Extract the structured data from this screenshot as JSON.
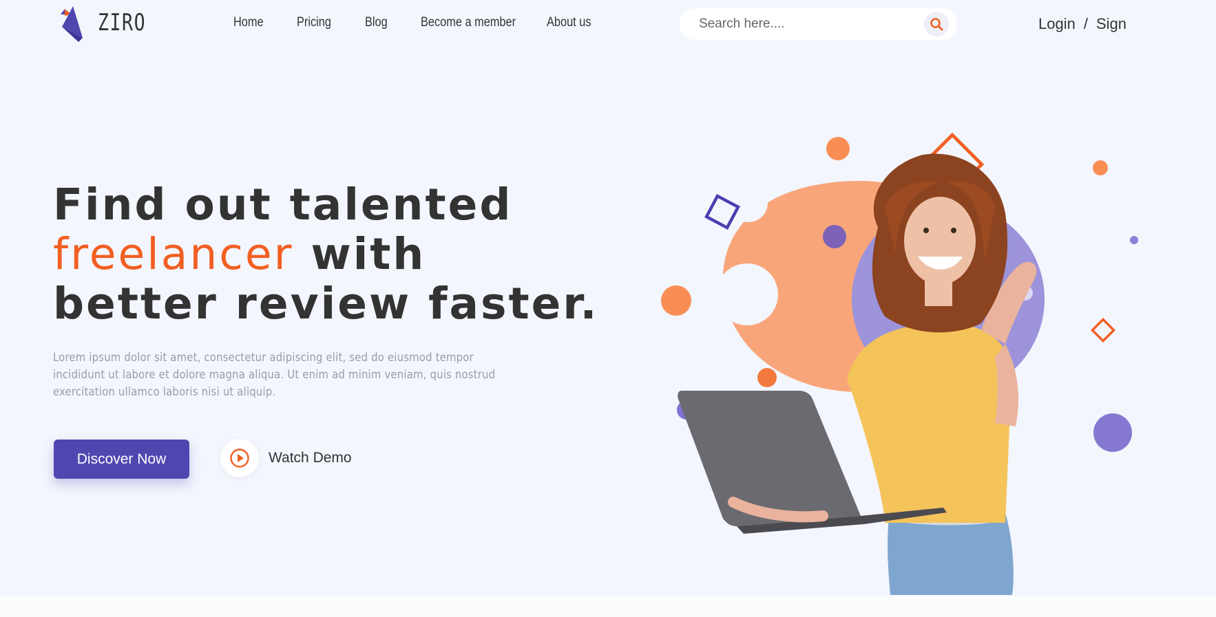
{
  "brand": {
    "name": "ZIRO",
    "colors": {
      "primary": "#4f47b0",
      "accent": "#f15f22",
      "background": "#f3f6fd"
    }
  },
  "nav": {
    "items": [
      {
        "label": "Home"
      },
      {
        "label": "Pricing"
      },
      {
        "label": "Blog"
      },
      {
        "label": "Become a member"
      },
      {
        "label": "About us"
      }
    ]
  },
  "search": {
    "placeholder": "Search here....",
    "icon": "search-icon"
  },
  "auth": {
    "login_label": "Login",
    "separator": "/",
    "sign_label": "Sign"
  },
  "hero": {
    "title_line1": "Find out talented",
    "title_accent": "freelancer",
    "title_line2_rest": " with",
    "title_line3": "better review faster.",
    "description": "Lorem ipsum dolor sit amet, consectetur adipiscing elit, sed do eiusmod tempor incididunt ut labore et dolore magna aliqua. Ut enim ad minim veniam, quis nostrud exercitation ullamco laboris nisi ut aliquip.",
    "primary_button": "Discover Now",
    "secondary_button": "Watch Demo",
    "secondary_icon": "play-icon"
  }
}
